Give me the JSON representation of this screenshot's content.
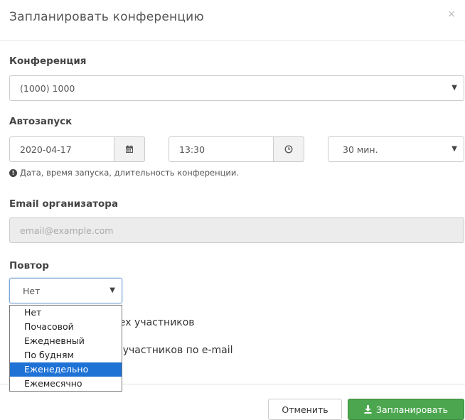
{
  "modal": {
    "title": "Запланировать конференцию",
    "close_icon": "×"
  },
  "conference": {
    "label": "Конференция",
    "value": "(1000) 1000"
  },
  "autostart": {
    "label": "Автозапуск",
    "date": "2020-04-17",
    "time": "13:30",
    "duration": "30 мин.",
    "hint": "Дата, время запуска, длительность конференции.",
    "hint_icon": "info-circle-icon"
  },
  "email": {
    "label": "Email организатора",
    "placeholder": "email@example.com"
  },
  "repeat": {
    "label": "Повтор",
    "value": "Нет",
    "options": [
      "Нет",
      "Почасовой",
      "Ежедневный",
      "По будням",
      "Еженедельно",
      "Ежемесячно"
    ],
    "selected_index": 4
  },
  "partially_hidden": {
    "line1": "сех участников",
    "line2": "ь участников по e-mail"
  },
  "footer": {
    "cancel_label": "Отменить",
    "save_label": "Запланировать"
  },
  "colors": {
    "save_button": "#4ca64f",
    "selected_option": "#1e72d6"
  }
}
